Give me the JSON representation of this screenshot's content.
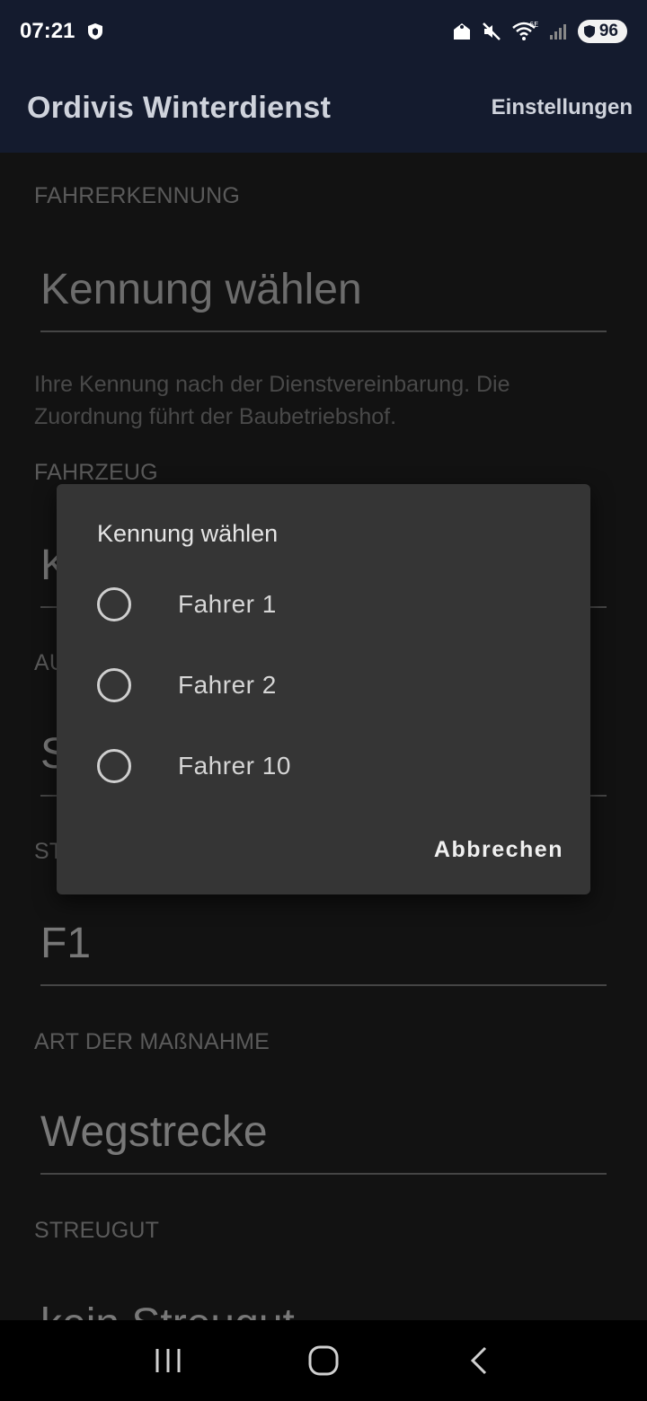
{
  "status_bar": {
    "time": "07:21",
    "battery": "96",
    "network": "6E"
  },
  "app_bar": {
    "title": "Ordivis Winterdienst",
    "settings_label": "Einstellungen"
  },
  "form": {
    "driver_section": "FAHRERKENNUNG",
    "driver_placeholder": "Kennung wählen",
    "driver_helper": "Ihre Kennung nach der Dienstvereinbarung. Die Zuordnung führt der Baubetriebshof.",
    "vehicle_section": "FAHRZEUG",
    "vehicle_value_partial": "K",
    "section3_partial": "AU",
    "field3_partial": "S",
    "section4_partial": "ST",
    "field4_value": "F1",
    "measure_section": "ART DER MAßNAHME",
    "measure_value": "Wegstrecke",
    "grit_section": "STREUGUT",
    "grit_value": "kein Streugut"
  },
  "dialog": {
    "title": "Kennung wählen",
    "options": [
      {
        "label": "Fahrer 1",
        "selected": false
      },
      {
        "label": "Fahrer 2",
        "selected": false
      },
      {
        "label": "Fahrer 10",
        "selected": false
      }
    ],
    "cancel_label": "Abbrechen"
  },
  "colors": {
    "app_bar": "#141b2e",
    "background": "#1c1c1c",
    "dialog": "#353535"
  }
}
